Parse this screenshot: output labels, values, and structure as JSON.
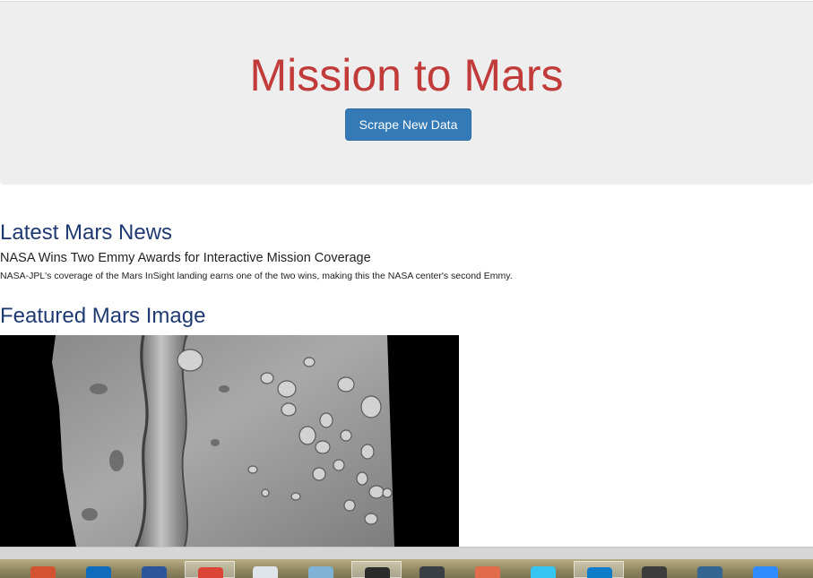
{
  "header": {
    "title": "Mission to Mars",
    "scrape_button_label": "Scrape New Data"
  },
  "news": {
    "section_title": "Latest Mars News",
    "headline": "NASA Wins Two Emmy Awards for Interactive Mission Coverage",
    "teaser": "NASA-JPL's coverage of the Mars InSight landing earns one of the two wins, making this the NASA center's second Emmy."
  },
  "featured_image": {
    "section_title": "Featured Mars Image"
  },
  "taskbar": {
    "apps": [
      {
        "icon": "powerpoint-icon",
        "color": "#d35230",
        "active": false
      },
      {
        "icon": "outlook-icon",
        "color": "#0f6cbd",
        "active": false
      },
      {
        "icon": "word-icon",
        "color": "#2b579a",
        "active": false
      },
      {
        "icon": "chrome-icon",
        "color": "#db4437",
        "active": true
      },
      {
        "icon": "file-explorer-icon",
        "color": "#dfe3ea",
        "active": false
      },
      {
        "icon": "notepad-icon",
        "color": "#7fb3d5",
        "active": false
      },
      {
        "icon": "command-prompt-icon",
        "color": "#2b2b2b",
        "active": true
      },
      {
        "icon": "terminal-icon",
        "color": "#3a3f44",
        "active": false
      },
      {
        "icon": "git-icon",
        "color": "#e06c4b",
        "active": false
      },
      {
        "icon": "slack-icon",
        "color": "#36c5f0",
        "active": false
      },
      {
        "icon": "vscode-icon",
        "color": "#0e7cc9",
        "active": true
      },
      {
        "icon": "window-icon",
        "color": "#3c3c3c",
        "active": false
      },
      {
        "icon": "postgres-icon",
        "color": "#336791",
        "active": false
      },
      {
        "icon": "zoom-icon",
        "color": "#2d8cff",
        "active": false
      }
    ]
  }
}
